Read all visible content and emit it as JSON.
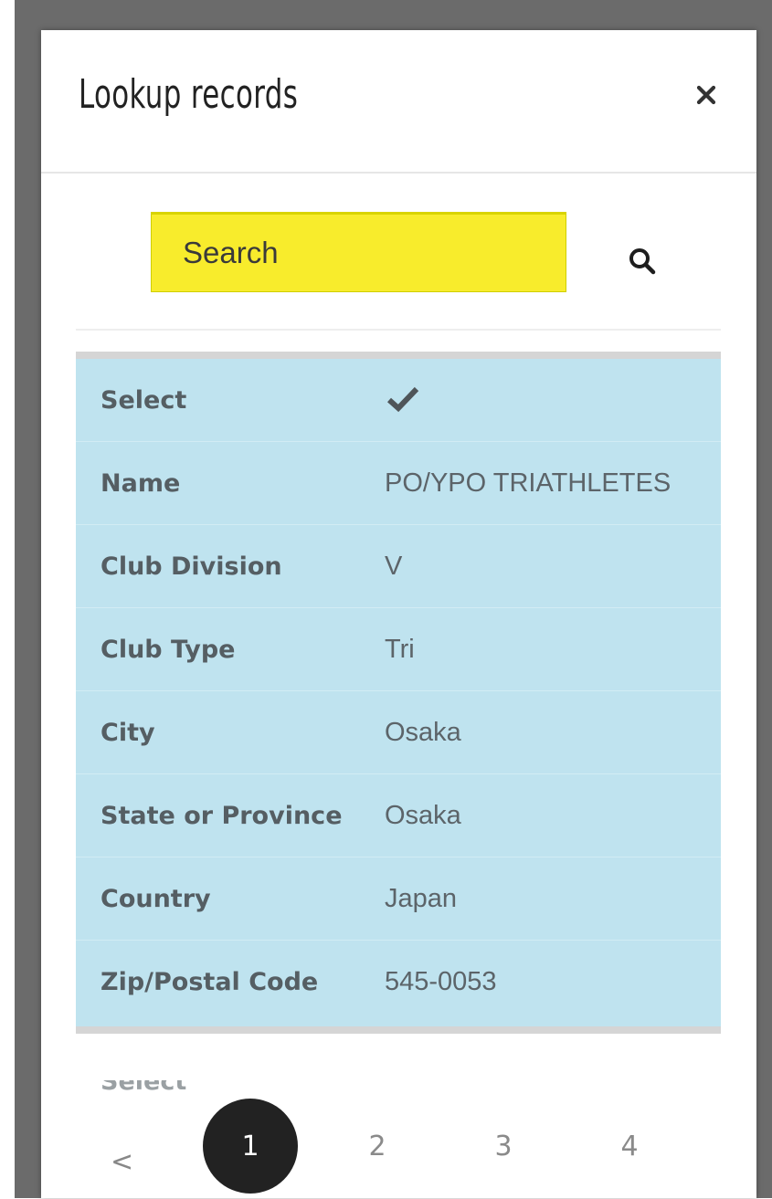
{
  "modal": {
    "title": "Lookup records",
    "close_icon": "close-icon"
  },
  "search": {
    "placeholder": "Search",
    "value": "",
    "highlight_color": "#f8ec2c",
    "button_icon": "search-icon"
  },
  "record": {
    "select_label": "Select",
    "select_icon": "checkmark-icon",
    "fields": [
      {
        "label": "Name",
        "value": "PO/YPO TRIATHLETES"
      },
      {
        "label": "Club Division",
        "value": "V"
      },
      {
        "label": "Club Type",
        "value": "Tri"
      },
      {
        "label": "City",
        "value": "Osaka"
      },
      {
        "label": "State or Province",
        "value": "Osaka"
      },
      {
        "label": "Country",
        "value": "Japan"
      },
      {
        "label": "Zip/Postal Code",
        "value": "545-0053"
      }
    ],
    "background_color": "#bfe3ef"
  },
  "next_record_label": "Select",
  "pagination": {
    "prev_label": "<",
    "pages": [
      "1",
      "2",
      "3",
      "4"
    ],
    "current_page": "1"
  }
}
